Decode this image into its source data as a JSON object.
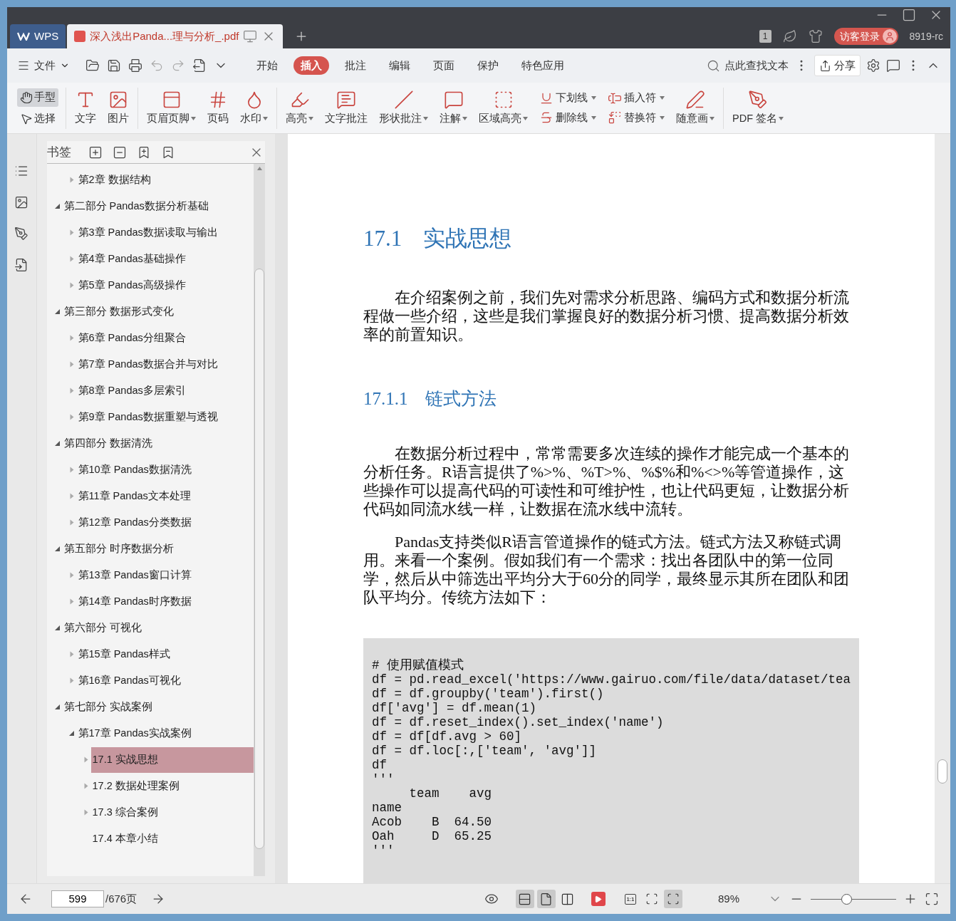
{
  "title_bar": {
    "tabs": [
      {
        "label": "WPS",
        "kind": "home",
        "selected": false
      },
      {
        "label": "深入浅出Panda...理与分析_.pdf",
        "kind": "doc",
        "selected": true
      }
    ],
    "badge": "1",
    "login": "访客登录",
    "version": "8919-rc"
  },
  "menu_bar": {
    "file": "文件",
    "tabs": [
      {
        "label": "开始",
        "selected": false
      },
      {
        "label": "插入",
        "selected": true
      },
      {
        "label": "批注",
        "selected": false
      },
      {
        "label": "编辑",
        "selected": false
      },
      {
        "label": "页面",
        "selected": false
      },
      {
        "label": "保护",
        "selected": false
      },
      {
        "label": "特色应用",
        "selected": false
      }
    ],
    "search": "点此查找文本",
    "share": "分享"
  },
  "ribbon": {
    "modes": [
      {
        "label": "手型",
        "selected": true
      },
      {
        "label": "选择",
        "selected": false
      }
    ],
    "groups": [
      [
        {
          "kind": "big",
          "label": "文字",
          "dropdown": false
        },
        {
          "kind": "big",
          "label": "图片",
          "dropdown": false
        }
      ],
      [
        {
          "kind": "big",
          "label": "页眉页脚",
          "dropdown": true
        },
        {
          "kind": "big",
          "label": "页码",
          "dropdown": false
        },
        {
          "kind": "big",
          "label": "水印",
          "dropdown": true
        }
      ],
      [
        {
          "kind": "big",
          "label": "高亮",
          "dropdown": true
        },
        {
          "kind": "big",
          "label": "文字批注",
          "dropdown": false
        },
        {
          "kind": "big",
          "label": "形状批注",
          "dropdown": true
        },
        {
          "kind": "big",
          "label": "注解",
          "dropdown": true
        },
        {
          "kind": "big",
          "label": "区域高亮",
          "dropdown": true
        },
        {
          "kind": "stack",
          "items": [
            {
              "label": "下划线",
              "dropdown": true
            },
            {
              "label": "删除线",
              "dropdown": true
            }
          ]
        },
        {
          "kind": "stack",
          "items": [
            {
              "label": "插入符",
              "dropdown": true
            },
            {
              "label": "替换符",
              "dropdown": true
            }
          ]
        },
        {
          "kind": "big",
          "label": "随意画",
          "dropdown": true
        }
      ],
      [
        {
          "kind": "big",
          "label": "PDF 签名",
          "dropdown": true
        }
      ]
    ]
  },
  "bookmarks": {
    "title": "书签",
    "continued": [
      {
        "label": "第2章 数据结构",
        "collapsible": true,
        "expanded": false,
        "selected": false
      }
    ],
    "items": [
      {
        "label": "第二部分 Pandas数据分析基础",
        "collapsible": true,
        "expanded": true,
        "selected": false,
        "children": [
          {
            "label": "第3章 Pandas数据读取与输出",
            "collapsible": true,
            "expanded": false,
            "selected": false
          },
          {
            "label": "第4章 Pandas基础操作",
            "collapsible": true,
            "expanded": false,
            "selected": false
          },
          {
            "label": "第5章 Pandas高级操作",
            "collapsible": true,
            "expanded": false,
            "selected": false
          }
        ]
      },
      {
        "label": "第三部分 数据形式变化",
        "collapsible": true,
        "expanded": true,
        "selected": false,
        "children": [
          {
            "label": "第6章 Pandas分组聚合",
            "collapsible": true,
            "expanded": false,
            "selected": false
          },
          {
            "label": "第7章 Pandas数据合并与对比",
            "collapsible": true,
            "expanded": false,
            "selected": false
          },
          {
            "label": "第8章 Pandas多层索引",
            "collapsible": true,
            "expanded": false,
            "selected": false
          },
          {
            "label": "第9章 Pandas数据重塑与透视",
            "collapsible": true,
            "expanded": false,
            "selected": false
          }
        ]
      },
      {
        "label": "第四部分 数据清洗",
        "collapsible": true,
        "expanded": true,
        "selected": false,
        "children": [
          {
            "label": "第10章 Pandas数据清洗",
            "collapsible": true,
            "expanded": false,
            "selected": false
          },
          {
            "label": "第11章 Pandas文本处理",
            "collapsible": true,
            "expanded": false,
            "selected": false
          },
          {
            "label": "第12章 Pandas分类数据",
            "collapsible": true,
            "expanded": false,
            "selected": false
          }
        ]
      },
      {
        "label": "第五部分 时序数据分析",
        "collapsible": true,
        "expanded": true,
        "selected": false,
        "children": [
          {
            "label": "第13章 Pandas窗口计算",
            "collapsible": true,
            "expanded": false,
            "selected": false
          },
          {
            "label": "第14章 Pandas时序数据",
            "collapsible": true,
            "expanded": false,
            "selected": false
          }
        ]
      },
      {
        "label": "第六部分 可视化",
        "collapsible": true,
        "expanded": true,
        "selected": false,
        "children": [
          {
            "label": "第15章 Pandas样式",
            "collapsible": true,
            "expanded": false,
            "selected": false
          },
          {
            "label": "第16章 Pandas可视化",
            "collapsible": true,
            "expanded": false,
            "selected": false
          }
        ]
      },
      {
        "label": "第七部分 实战案例",
        "collapsible": true,
        "expanded": true,
        "selected": false,
        "children": [
          {
            "label": "第17章 Pandas实战案例",
            "collapsible": true,
            "expanded": true,
            "selected": false,
            "children": [
              {
                "label": "17.1 实战思想",
                "collapsible": true,
                "expanded": false,
                "selected": true
              },
              {
                "label": "17.2 数据处理案例",
                "collapsible": true,
                "expanded": false,
                "selected": false
              },
              {
                "label": "17.3 综合案例",
                "collapsible": true,
                "expanded": false,
                "selected": false
              },
              {
                "label": "17.4 本章小结",
                "collapsible": false,
                "selected": false
              }
            ]
          }
        ]
      }
    ]
  },
  "document": {
    "blocks": [
      {
        "kind": "h1",
        "number": "17.1",
        "text": "实战思想"
      },
      {
        "kind": "p",
        "text": "在介绍案例之前，我们先对需求分析思路、编码方式和数据分析流程做一些介绍，这些是我们掌握良好的数据分析习惯、提高数据分析效率的前置知识。"
      },
      {
        "kind": "h2",
        "number": "17.1.1",
        "text": "链式方法"
      },
      {
        "kind": "p",
        "text": "在数据分析过程中，常常需要多次连续的操作才能完成一个基本的分析任务。R语言提供了%>%、%T>%、%$%和%<>%等管道操作，这些操作可以提高代码的可读性和可维护性，也让代码更短，让数据分析代码如同流水线一样，让数据在流水线中流转。"
      },
      {
        "kind": "p",
        "text": "Pandas支持类似R语言管道操作的链式方法。链式方法又称链式调用。来看一个案例。假如我们有一个需求：找出各团队中的第一位同学，然后从中筛选出平均分大于60分的同学，最终显示其所在团队和团队平均分。传统方法如下："
      },
      {
        "kind": "code",
        "lines": [
          "# 使用赋值模式",
          "df = pd.read_excel('https://www.gairuo.com/file/data/dataset/tea",
          "df = df.groupby('team').first()",
          "df['avg'] = df.mean(1)",
          "df = df.reset_index().set_index('name')",
          "df = df[df.avg > 60]",
          "df = df.loc[:,['team', 'avg']]",
          "df",
          "'''",
          "     team    avg",
          "name",
          "Acob    B  64.50",
          "Oah     D  65.25",
          "'''"
        ]
      }
    ]
  },
  "status_bar": {
    "page": "599",
    "total": "/676页",
    "view_modes": [
      {
        "selected": true
      },
      {
        "selected": true
      },
      {
        "selected": false
      }
    ],
    "fit_modes": [
      {
        "label": "1:1",
        "selected": false
      },
      {
        "selected": false
      },
      {
        "selected": true
      }
    ],
    "zoom": "89%",
    "zoom_slider": {
      "level": 0.42
    }
  }
}
